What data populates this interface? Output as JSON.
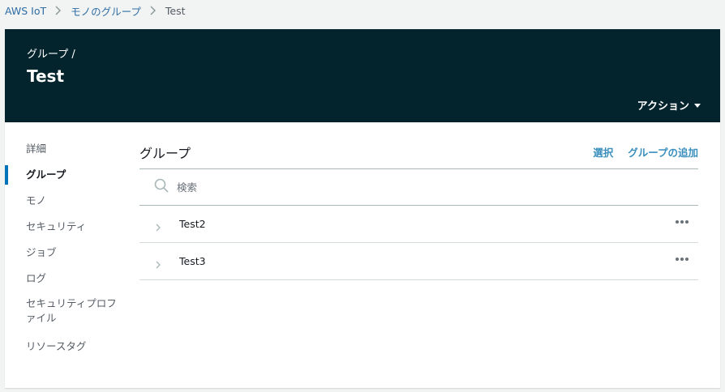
{
  "breadcrumb": {
    "items": [
      "AWS IoT",
      "モノのグループ"
    ],
    "current": "Test"
  },
  "header": {
    "subtitle": "グループ /",
    "title": "Test",
    "action_label": "アクション"
  },
  "nav": {
    "items": [
      {
        "label": "詳細"
      },
      {
        "label": "グループ"
      },
      {
        "label": "モノ"
      },
      {
        "label": "セキュリティ"
      },
      {
        "label": "ジョブ"
      },
      {
        "label": "ログ"
      },
      {
        "label": "セキュリティプロファイル"
      },
      {
        "label": "リソースタグ"
      }
    ],
    "active": "グループ"
  },
  "main": {
    "title": "グループ",
    "select_label": "選択",
    "add_label": "グループの追加",
    "search_placeholder": "検索",
    "rows": [
      {
        "label": "Test2"
      },
      {
        "label": "Test3"
      }
    ]
  },
  "colors": {
    "header_bg": "#03242d",
    "link": "#2e6da4",
    "action_link": "#3a8fbd",
    "active_indicator": "#0073bb"
  }
}
